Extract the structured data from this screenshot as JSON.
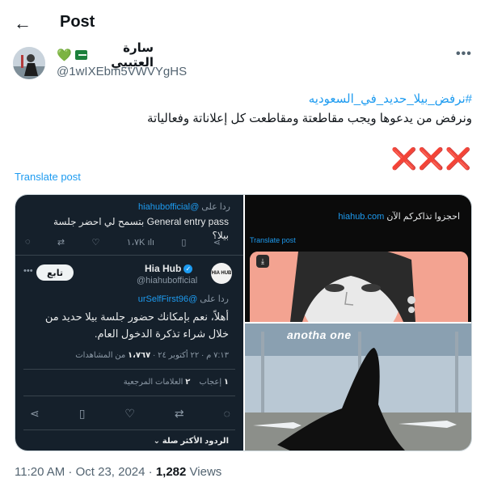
{
  "header": {
    "back_label": "←",
    "title": "Post"
  },
  "author": {
    "display_name": "سارة العتيبي",
    "heart_glyph": "💚",
    "handle": "@1wIXEbm5VWVYgHS",
    "avatar_description_icon": "profile-photo-icon"
  },
  "more_label": "•••",
  "post": {
    "hashtag": "#نرفض_بيلا_حديد_في_السعوديه",
    "text": "ونرفض من يدعوها ويجب مقاطعتة ومقاطعت كل إعلاناتة وفعالياتة",
    "emphasis": "❌❌❌",
    "translate_label": "Translate post"
  },
  "media": {
    "left": {
      "reply_prefix": "ردا على",
      "reply_user": "@hiahubofficial",
      "reply_text": "General entry pass بتسمح لي احضر جلسة بيلا؟",
      "action_views": "١،٧K",
      "account_name": "Hia Hub",
      "verified_glyph": "✓",
      "avatar_text": "HIA HUB",
      "account_handle": "@hiahubofficial",
      "follow_label": "تابع",
      "dots": "•••",
      "reply2_prefix": "ردا على",
      "reply2_user": "@urSelfFirst96",
      "body_text": "أهلاً، نعم بإمكانك حضور جلسة بيلا حديد من خلال شراء تذكرة الدخول العام.",
      "meta_time": "٧:١٣ م · ٢٢ أكتوبر ٢٤ ·",
      "meta_views_count": "١،٧٦٧",
      "meta_views_label": "من المشاهدات",
      "likes_count": "١",
      "likes_label": "إعجاب",
      "bookmarks_count": "٢",
      "bookmarks_label": "العلامات المرجعية",
      "sort_label": "الردود الأكثر صلة ⌄"
    },
    "right_top": {
      "text_prefix": "احجزوا تذاكركم الآن",
      "text_link": "hiahub.com",
      "translate_label": "Translate post",
      "download_glyph": "⤓"
    },
    "right_bottom": {
      "caption": "anotha one"
    }
  },
  "footer": {
    "timestamp": "11:20 AM · Oct 23, 2024 ·",
    "views_count": "1,282",
    "views_label": "Views"
  }
}
